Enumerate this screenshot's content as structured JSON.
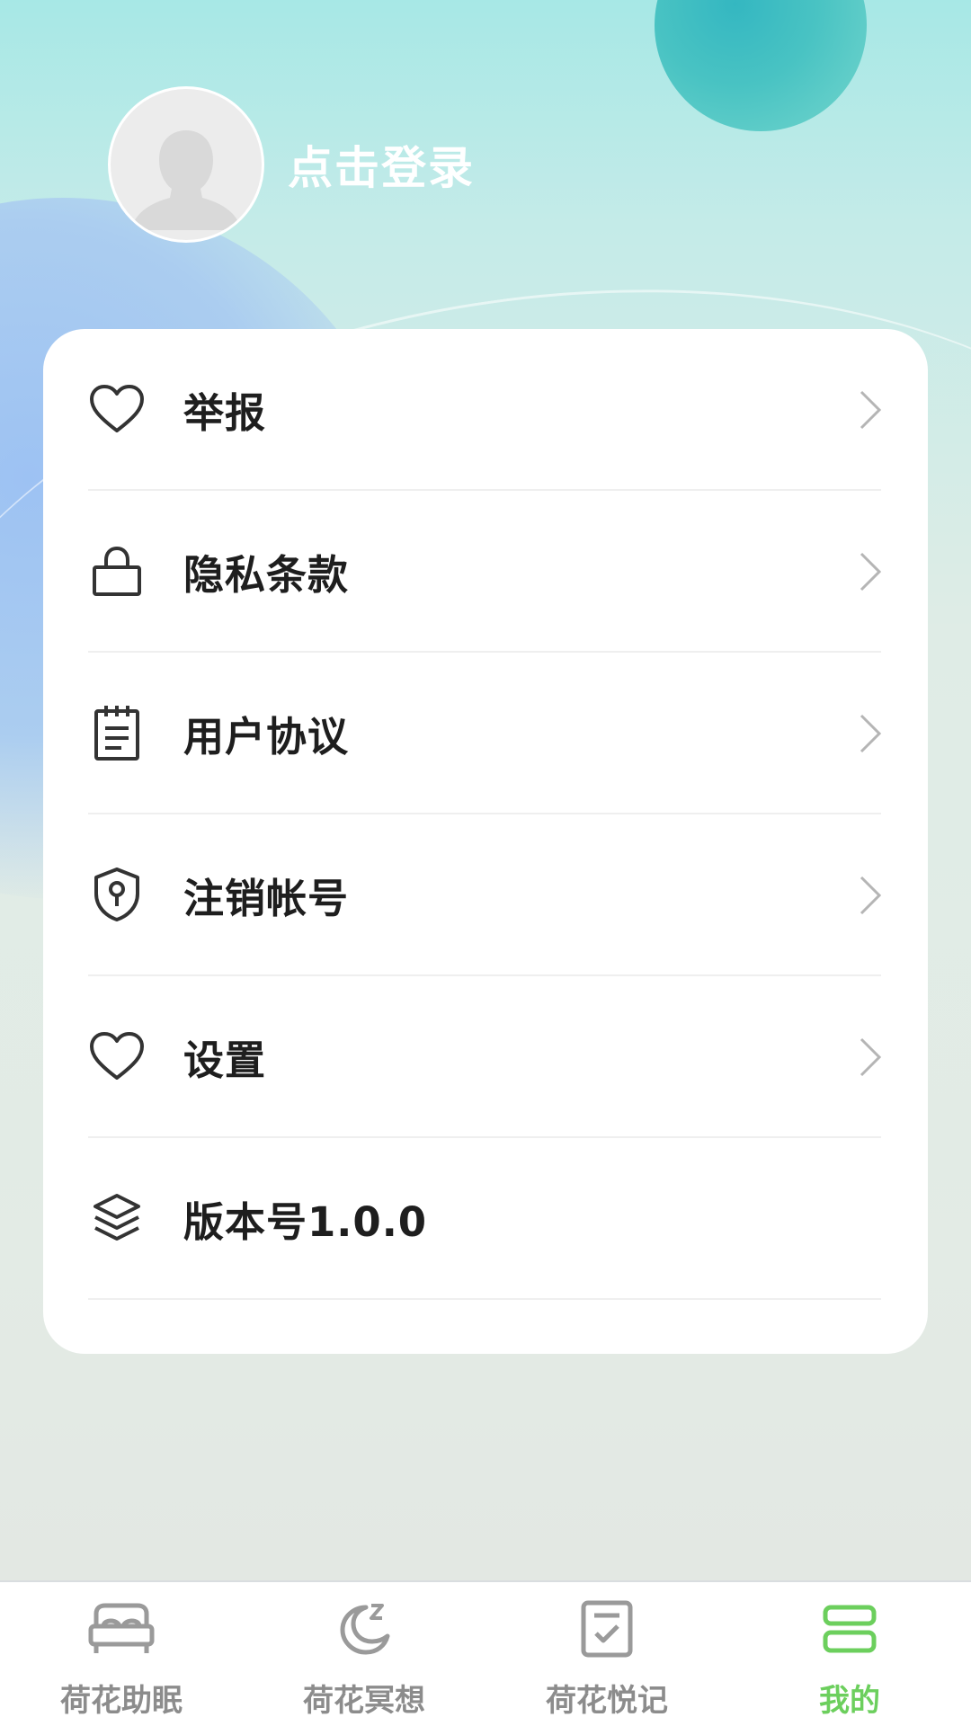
{
  "profile": {
    "login_label": "点击登录"
  },
  "menu": {
    "items": [
      {
        "label": "举报",
        "icon": "heart-icon",
        "has_arrow": true
      },
      {
        "label": "隐私条款",
        "icon": "lock-icon",
        "has_arrow": true
      },
      {
        "label": "用户协议",
        "icon": "notepad-icon",
        "has_arrow": true
      },
      {
        "label": "注销帐号",
        "icon": "shield-keyhole-icon",
        "has_arrow": true
      },
      {
        "label": "设置",
        "icon": "heart-icon",
        "has_arrow": true
      },
      {
        "label": "版本号1.0.0",
        "icon": "layers-icon",
        "has_arrow": false
      }
    ]
  },
  "tabbar": {
    "items": [
      {
        "label": "荷花助眠",
        "icon": "bed-icon",
        "active": false
      },
      {
        "label": "荷花冥想",
        "icon": "moon-icon",
        "active": false
      },
      {
        "label": "荷花悦记",
        "icon": "checklist-icon",
        "active": false
      },
      {
        "label": "我的",
        "icon": "profile-cards-icon",
        "active": true
      }
    ]
  },
  "colors": {
    "active_tab": "#6ccf5d",
    "inactive_tab": "#8c8c8c",
    "menu_text": "#1e1e1e",
    "accent_orb": "#3bb8c2"
  }
}
